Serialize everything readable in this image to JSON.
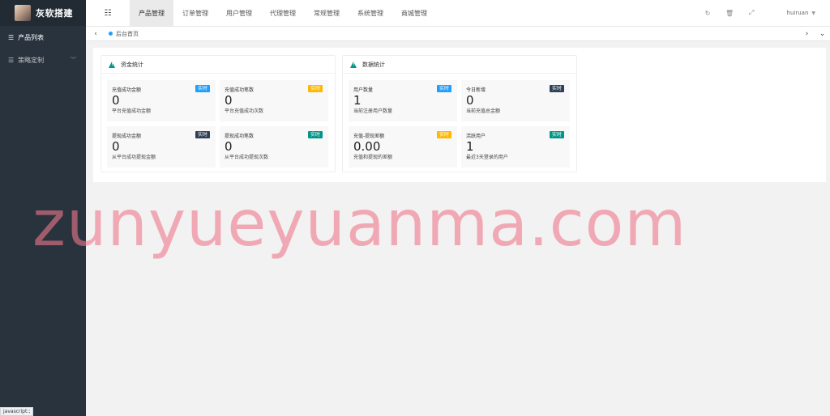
{
  "brand": {
    "title": "灰软搭建"
  },
  "sidebar": {
    "items": [
      {
        "label": "产品列表",
        "icon": "list-icon",
        "active": true
      },
      {
        "label": "策略定制",
        "icon": "list-icon",
        "active": false,
        "has_children": true
      }
    ]
  },
  "header": {
    "toggle_icon": "menu-toggle-icon",
    "tabs": [
      {
        "label": "产品管理",
        "active": true
      },
      {
        "label": "订单管理"
      },
      {
        "label": "用户管理"
      },
      {
        "label": "代理管理"
      },
      {
        "label": "常规管理"
      },
      {
        "label": "系统管理"
      },
      {
        "label": "商城管理"
      }
    ],
    "user": "huiruan"
  },
  "tabstrip": {
    "home_label": "后台首页"
  },
  "panels": [
    {
      "title": "资金统计",
      "cards": [
        {
          "title": "充值成功金额",
          "badge": "实时",
          "badge_color": "#1e9fff",
          "value": "0",
          "sub": "平台充值成功金额"
        },
        {
          "title": "充值成功笔数",
          "badge": "实时",
          "badge_color": "#ffb800",
          "value": "0",
          "sub": "平台充值成功次数"
        },
        {
          "title": "提现成功金额",
          "badge": "实时",
          "badge_color": "#2f4056",
          "value": "0",
          "sub": "从平台成功提现金额"
        },
        {
          "title": "提现成功笔数",
          "badge": "实时",
          "badge_color": "#009688",
          "value": "0",
          "sub": "从平台成功提现次数"
        }
      ]
    },
    {
      "title": "数据统计",
      "cards": [
        {
          "title": "用户数量",
          "badge": "实时",
          "badge_color": "#1e9fff",
          "value": "1",
          "sub": "当前注册用户数量"
        },
        {
          "title": "今日新增",
          "badge": "实时",
          "badge_color": "#2f4056",
          "value": "0",
          "sub": "当前充值总金额"
        },
        {
          "title": "充值-提现差额",
          "badge": "实时",
          "badge_color": "#ffb800",
          "value": "0.00",
          "sub": "充值和提现的差额"
        },
        {
          "title": "活跃用户",
          "badge": "实时",
          "badge_color": "#009688",
          "value": "1",
          "sub": "最近3天登录的用户"
        }
      ]
    }
  ],
  "watermark": "zunyueyuanma.com",
  "status": "javascript:;"
}
